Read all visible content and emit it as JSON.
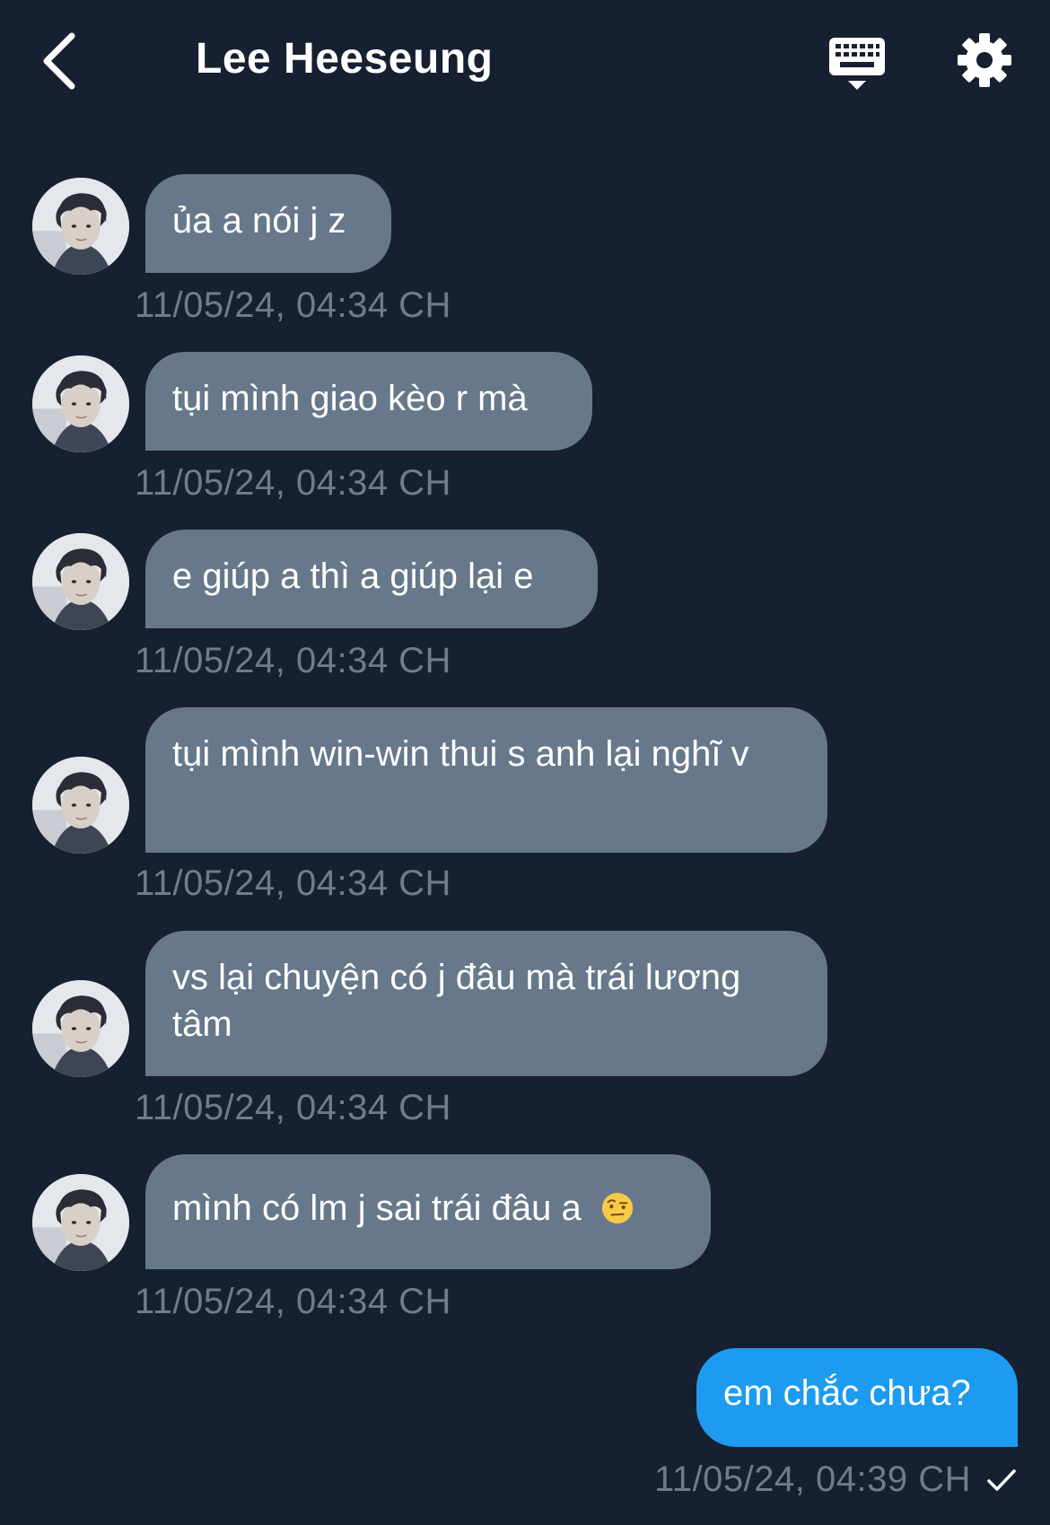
{
  "header": {
    "title": "Lee Heeseung",
    "back_icon": "chevron-left-icon",
    "keyboard_icon": "keyboard-icon",
    "settings_icon": "gear-icon"
  },
  "messages": [
    {
      "direction": "incoming",
      "text": "ủa a nói j z",
      "time": "11/05/24, 04:34 CH"
    },
    {
      "direction": "incoming",
      "text": "tụi mình giao kèo r mà",
      "time": "11/05/24, 04:34 CH"
    },
    {
      "direction": "incoming",
      "text": "e giúp a thì a giúp lại e",
      "time": "11/05/24, 04:34 CH"
    },
    {
      "direction": "incoming",
      "text": "tụi mình win-win thui s anh lại nghĩ v",
      "time": "11/05/24, 04:34 CH"
    },
    {
      "direction": "incoming",
      "text": "vs lại chuyện có j đâu mà trái lương tâm",
      "time": "11/05/24, 04:34 CH"
    },
    {
      "direction": "incoming",
      "text": "mình có lm j sai trái đâu a",
      "emoji": "raised-eyebrow-emoji",
      "time": "11/05/24, 04:34 CH"
    },
    {
      "direction": "outgoing",
      "text": "em chắc chưa?",
      "time": "11/05/24, 04:39 CH",
      "status_icon": "checkmark-icon"
    }
  ],
  "colors": {
    "background": "#172030",
    "incoming_bubble": "#66788a",
    "outgoing_bubble": "#1d9bf0",
    "timestamp": "#6f7c89"
  }
}
